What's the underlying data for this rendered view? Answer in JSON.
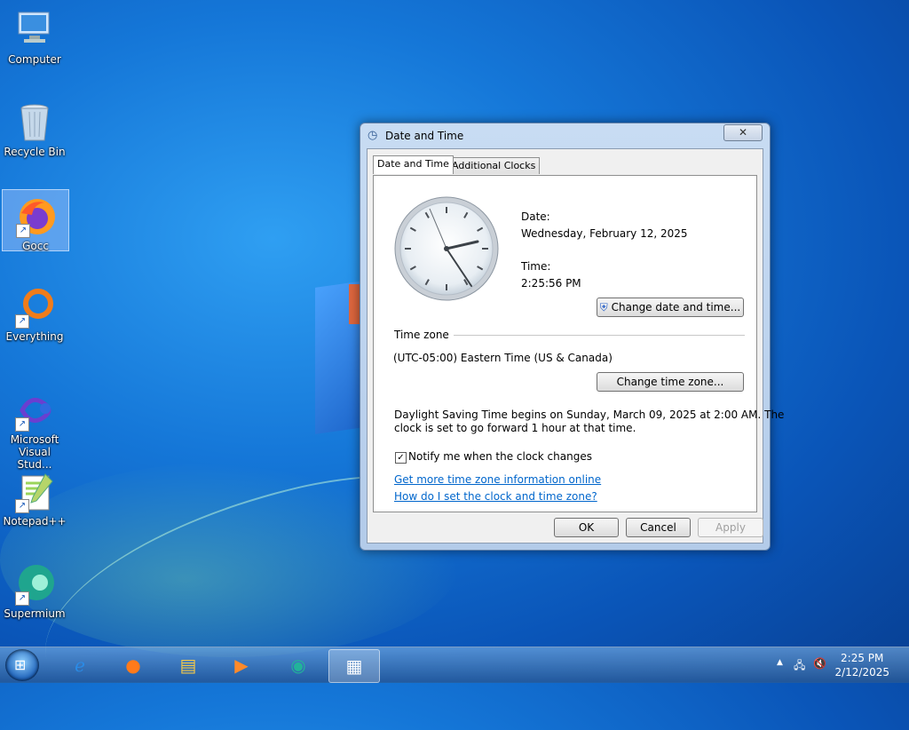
{
  "desktop": {
    "icons": [
      {
        "label": "Computer"
      },
      {
        "label": "Recycle Bin"
      },
      {
        "label": "Gocc"
      },
      {
        "label": "Everything"
      },
      {
        "label_line1": "Microsoft",
        "label_line2": "Visual Stud..."
      },
      {
        "label": "Notepad++"
      },
      {
        "label": "Supermium"
      }
    ]
  },
  "window": {
    "title": "Date and Time",
    "close_glyph": "✕",
    "tabs": [
      "Date and Time",
      "Additional Clocks"
    ],
    "date_label": "Date:",
    "date_value": "Wednesday, February 12, 2025",
    "time_label": "Time:",
    "time_value": "2:25:56 PM",
    "change_datetime_button": "Change date and time...",
    "timezone_group": "Time zone",
    "timezone_value": "(UTC-05:00) Eastern Time (US & Canada)",
    "change_timezone_button": "Change time zone...",
    "dst_line1": "Daylight Saving Time begins on Sunday, March 09, 2025 at 2:00 AM. The",
    "dst_line2": "clock is set to go forward 1 hour at that time.",
    "notify_checkbox_label": "Notify me when the clock changes",
    "notify_checked": true,
    "link_more_info": "Get more time zone information online",
    "link_how_to": "How do I set the clock and time zone?",
    "ok_button": "OK",
    "cancel_button": "Cancel",
    "apply_button": "Apply"
  },
  "taskbar": {
    "tray_time": "2:25 PM",
    "tray_date": "2/12/2025",
    "show_hidden_glyph": "▲"
  },
  "colors": {
    "link": "#0066cc",
    "desktop_blue": "#1577d8"
  }
}
